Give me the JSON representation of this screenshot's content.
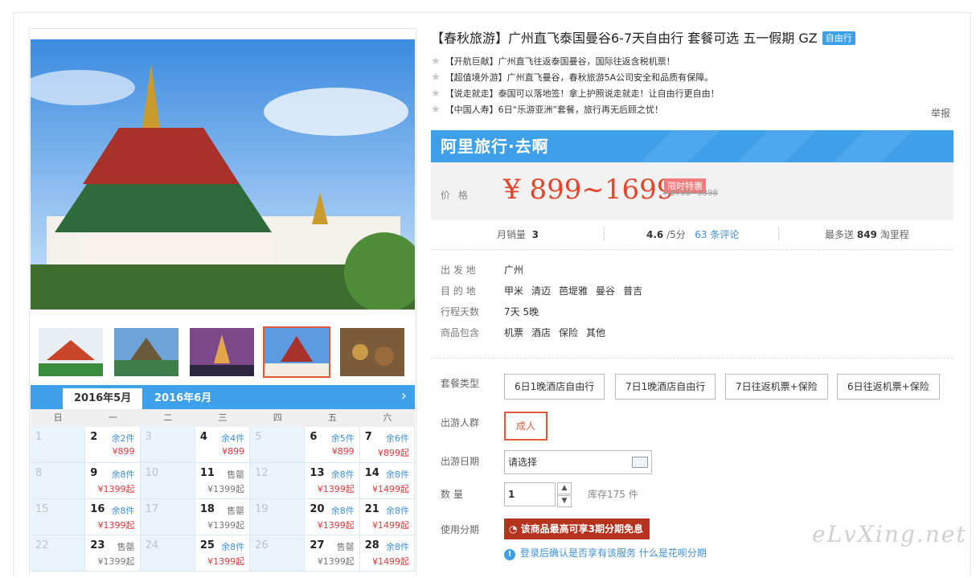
{
  "title": "【春秋旅游】广州直飞泰国曼谷6-7天自由行 套餐可选 五一假期 GZ",
  "title_badge": "自由行",
  "features": [
    "【开航巨献】广州直飞往返泰国曼谷，国际往返含税机票！",
    "【超值境外游】广州直飞曼谷，春秋旅游5A公司安全和品质有保障。",
    "【说走就走】泰国可以落地签！拿上护照说走就走！让自由行更自由！",
    "【中国人寿】6日“乐游亚洲”套餐，旅行再无后顾之忧！"
  ],
  "report_label": "举报",
  "banner_text": "阿里旅行·去啊",
  "price": {
    "label": "价格",
    "value": "¥ 899~1699",
    "promo": "限时特惠",
    "old": "¥ 1798~3398"
  },
  "stats": {
    "sales_label": "月销量",
    "sales": "3",
    "rating": "4.6",
    "rating_suffix": "/5分",
    "reviews": "63 条评论",
    "points_prefix": "最多送",
    "points": "849",
    "points_suffix": "淘里程"
  },
  "info": [
    {
      "key": "出 发 地",
      "values": [
        "广州"
      ]
    },
    {
      "key": "目 的 地",
      "values": [
        "甲米",
        "清迈",
        "芭堤雅",
        "曼谷",
        "普吉"
      ]
    },
    {
      "key": "行程天数",
      "values": [
        "7天 5晚"
      ]
    },
    {
      "key": "商品包含",
      "values": [
        "机票",
        "酒店",
        "保险",
        "其他"
      ]
    }
  ],
  "options": {
    "package_label": "套餐类型",
    "packages": [
      "6日1晚酒店自由行",
      "7日1晚酒店自由行",
      "7日往返机票+保险",
      "6日往返机票+保险"
    ],
    "crowd_label": "出游人群",
    "crowd": "成人",
    "date_label": "出游日期",
    "date_placeholder": "请选择",
    "qty_label": "数  量",
    "qty": "1",
    "stock": "库存175 件",
    "installment_label": "使用分期",
    "installment": "该商品最高可享3期分期免息",
    "login_tip": "登录后确认是否享有该服务",
    "login_link": "什么是花呗分期"
  },
  "calendar": {
    "month_active": "2016年5月",
    "month_next": "2016年6月",
    "weekdays": [
      "日",
      "一",
      "二",
      "三",
      "四",
      "五",
      "六"
    ],
    "cells": [
      {
        "d": "1",
        "s": "",
        "p": "",
        "a": false
      },
      {
        "d": "2",
        "s": "余2件",
        "p": "¥899",
        "a": true
      },
      {
        "d": "3",
        "s": "",
        "p": "",
        "a": false
      },
      {
        "d": "4",
        "s": "余4件",
        "p": "¥899",
        "a": true
      },
      {
        "d": "5",
        "s": "",
        "p": "",
        "a": false
      },
      {
        "d": "6",
        "s": "余5件",
        "p": "¥899",
        "a": true
      },
      {
        "d": "7",
        "s": "余6件",
        "p": "¥899起",
        "a": true
      },
      {
        "d": "8",
        "s": "",
        "p": "",
        "a": false
      },
      {
        "d": "9",
        "s": "余8件",
        "p": "¥1399起",
        "a": true
      },
      {
        "d": "10",
        "s": "",
        "p": "",
        "a": false
      },
      {
        "d": "11",
        "s": "售罄",
        "p": "¥1399起",
        "a": true,
        "so": true
      },
      {
        "d": "12",
        "s": "",
        "p": "",
        "a": false
      },
      {
        "d": "13",
        "s": "余8件",
        "p": "¥1399起",
        "a": true
      },
      {
        "d": "14",
        "s": "余8件",
        "p": "¥1499起",
        "a": true
      },
      {
        "d": "15",
        "s": "",
        "p": "",
        "a": false
      },
      {
        "d": "16",
        "s": "余8件",
        "p": "¥1399起",
        "a": true
      },
      {
        "d": "17",
        "s": "",
        "p": "",
        "a": false
      },
      {
        "d": "18",
        "s": "售罄",
        "p": "¥1399起",
        "a": true,
        "so": true
      },
      {
        "d": "19",
        "s": "",
        "p": "",
        "a": false
      },
      {
        "d": "20",
        "s": "余8件",
        "p": "¥1399起",
        "a": true
      },
      {
        "d": "21",
        "s": "余8件",
        "p": "¥1499起",
        "a": true
      },
      {
        "d": "22",
        "s": "",
        "p": "",
        "a": false
      },
      {
        "d": "23",
        "s": "售罄",
        "p": "¥1399起",
        "a": true,
        "so": true
      },
      {
        "d": "24",
        "s": "",
        "p": "",
        "a": false
      },
      {
        "d": "25",
        "s": "余8件",
        "p": "¥1399起",
        "a": true
      },
      {
        "d": "26",
        "s": "",
        "p": "",
        "a": false
      },
      {
        "d": "27",
        "s": "售罄",
        "p": "¥1399起",
        "a": true,
        "so": true
      },
      {
        "d": "28",
        "s": "余8件",
        "p": "¥1499起",
        "a": true
      }
    ]
  },
  "watermark": "eLvXing.net",
  "colors": {
    "accent": "#3fa0ea",
    "price": "#e5432a",
    "selected": "#e05a3a"
  }
}
